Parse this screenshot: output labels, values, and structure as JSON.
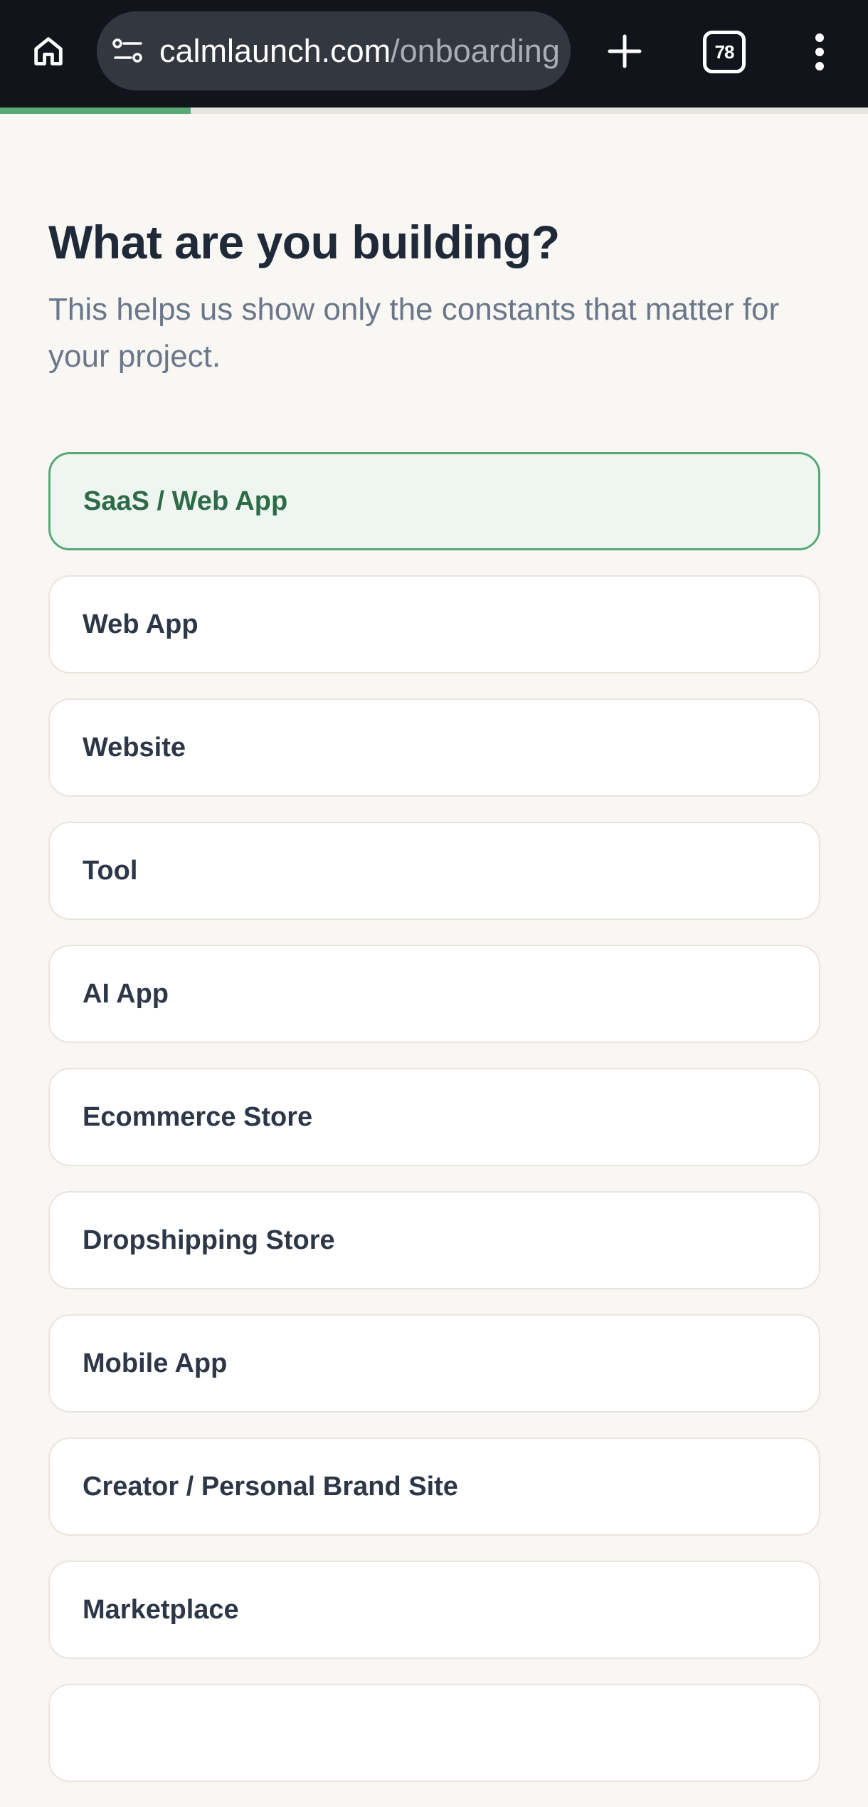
{
  "browser": {
    "url_host": "calmlaunch.com",
    "url_path": "/onboarding",
    "tab_count": "78",
    "icons": {
      "home": "home-icon",
      "site_info": "site-settings-icon",
      "new_tab": "plus-icon",
      "tabs": "tab-switcher-icon",
      "menu": "kebab-menu-icon"
    }
  },
  "onboarding": {
    "progress_fraction": 0.22,
    "progress_color": "#5aa777",
    "title": "What are you building?",
    "subtitle": "This helps us show only the constants that matter for your project.",
    "selected_option": "SaaS / Web App",
    "options": [
      {
        "label": "SaaS / Web App",
        "selected": true
      },
      {
        "label": "Web App",
        "selected": false
      },
      {
        "label": "Website",
        "selected": false
      },
      {
        "label": "Tool",
        "selected": false
      },
      {
        "label": "AI App",
        "selected": false
      },
      {
        "label": "Ecommerce Store",
        "selected": false
      },
      {
        "label": "Dropshipping Store",
        "selected": false
      },
      {
        "label": "Mobile App",
        "selected": false
      },
      {
        "label": "Creator / Personal Brand Site",
        "selected": false
      },
      {
        "label": "Marketplace",
        "selected": false
      },
      {
        "label": "",
        "selected": false
      }
    ]
  },
  "colors": {
    "accent": "#5aa777",
    "selected_background": "#eff6f1",
    "selected_text": "#2d6a47",
    "page_background": "#f8f7f4",
    "browser_bar": "#11141b"
  }
}
